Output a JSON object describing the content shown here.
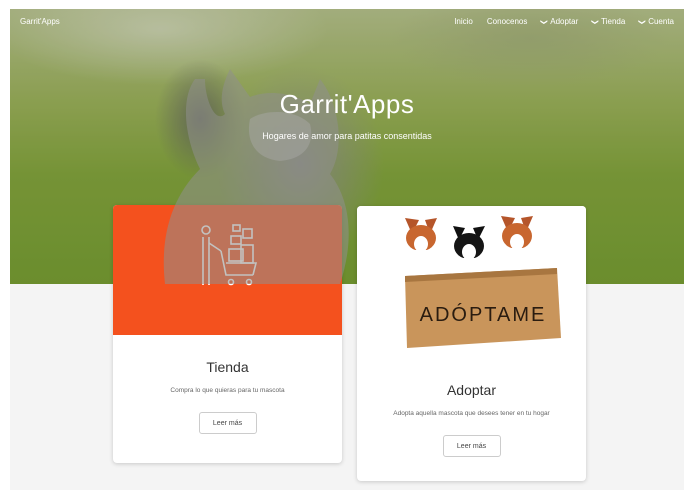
{
  "header": {
    "brand": "Garrit'Apps",
    "nav": [
      {
        "label": "Inicio",
        "dropdown": false
      },
      {
        "label": "Conocenos",
        "dropdown": false
      },
      {
        "label": "Adoptar",
        "dropdown": true
      },
      {
        "label": "Tienda",
        "dropdown": true
      },
      {
        "label": "Cuenta",
        "dropdown": true
      }
    ]
  },
  "hero": {
    "title": "Garrit'Apps",
    "subtitle": "Hogares de amor para patitas consentidas"
  },
  "cards": [
    {
      "title": "Tienda",
      "description": "Compra lo que quieras para tu mascota",
      "button": "Leer más",
      "media_color": "#f4511e",
      "icon": "shopping-cart-icon"
    },
    {
      "title": "Adoptar",
      "description": "Adopta aquella mascota que desees tener en tu hogar",
      "button": "Leer más",
      "box_text": "ADÓPTAME"
    }
  ],
  "colors": {
    "accent": "#f4511e",
    "background": "#f4f4f4"
  }
}
